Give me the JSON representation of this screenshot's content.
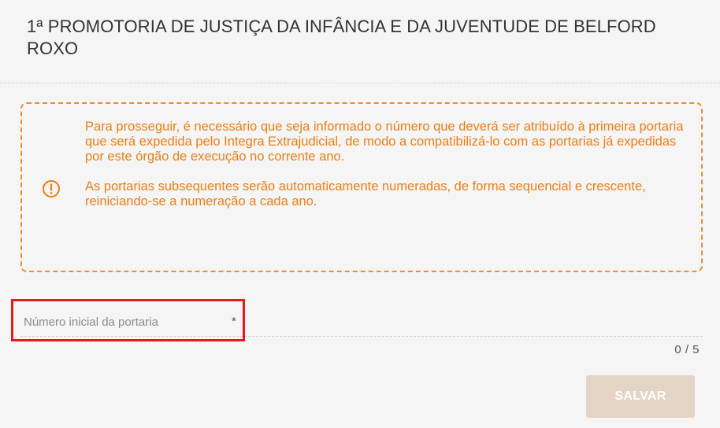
{
  "header": {
    "title": "1ª PROMOTORIA DE JUSTIÇA DA INFÂNCIA E DA JUVENTUDE DE BELFORD ROXO"
  },
  "warning": {
    "icon": "exclamation-circle-icon",
    "paragraph1": "Para prosseguir, é necessário que seja informado o número que deverá ser atribuído à primeira portaria que será expedida pelo Integra Extrajudicial, de modo a compatibilizá-lo com as portarias já expedidas por este órgão de execução no corrente ano.",
    "paragraph2": "As portarias subsequentes serão automaticamente numeradas, de forma sequencial e crescente, reiniciando-se a numeração a cada ano.",
    "color": "#ef7d13"
  },
  "form": {
    "field_placeholder": "Número inicial da portaria",
    "required_mark": "*",
    "field_value": "",
    "counter": "0 / 5"
  },
  "actions": {
    "save_label": "SALVAR"
  },
  "colors": {
    "accent": "#ef8c2c",
    "highlight": "#e6191c",
    "button_disabled": "#e4d4c6"
  }
}
